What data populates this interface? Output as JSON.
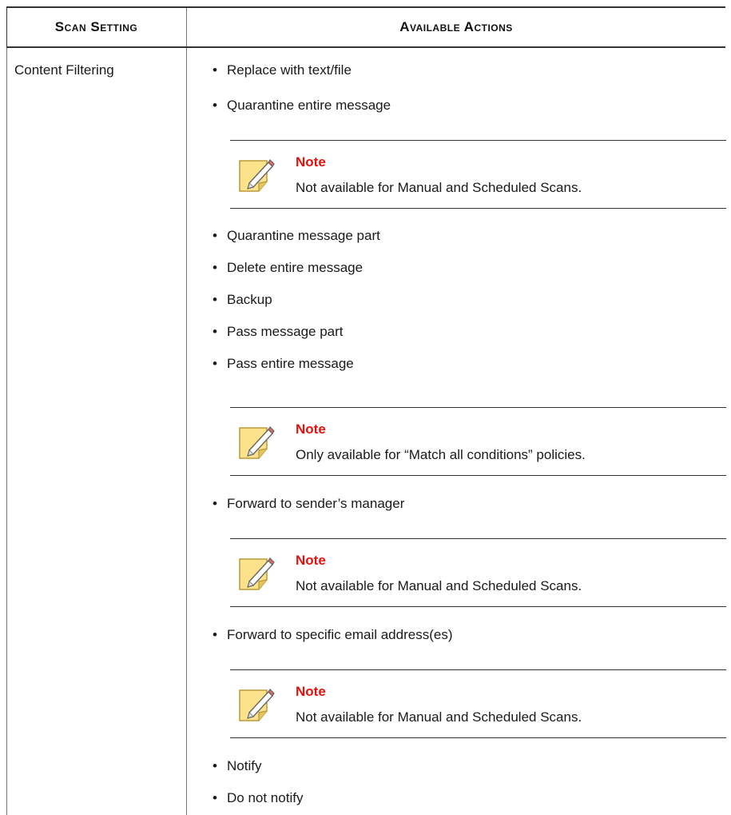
{
  "table": {
    "headers": [
      "Scan Setting",
      "Available Actions"
    ],
    "setting": "Content Filtering",
    "actions": [
      "Replace with text/file",
      "Quarantine entire message",
      "Quarantine message part",
      "Delete entire message",
      "Backup",
      "Pass message part",
      "Pass entire message",
      "Forward to sender’s manager",
      "Forward to specific email address(es)",
      "Notify",
      "Do not notify"
    ],
    "notes": [
      {
        "title": "Note",
        "text": "Not available for Manual and Scheduled Scans."
      },
      {
        "title": "Note",
        "text": "Only available for “Match all conditions” policies."
      },
      {
        "title": "Note",
        "text": "Not available for Manual and Scheduled Scans."
      },
      {
        "title": "Note",
        "text": "Not available for Manual and Scheduled Scans."
      }
    ]
  },
  "colors": {
    "note_title": "#e8100c",
    "note_icon_fill": "#fce28a",
    "rule": "#333333"
  },
  "icons": {
    "note": "note-pencil-icon"
  }
}
